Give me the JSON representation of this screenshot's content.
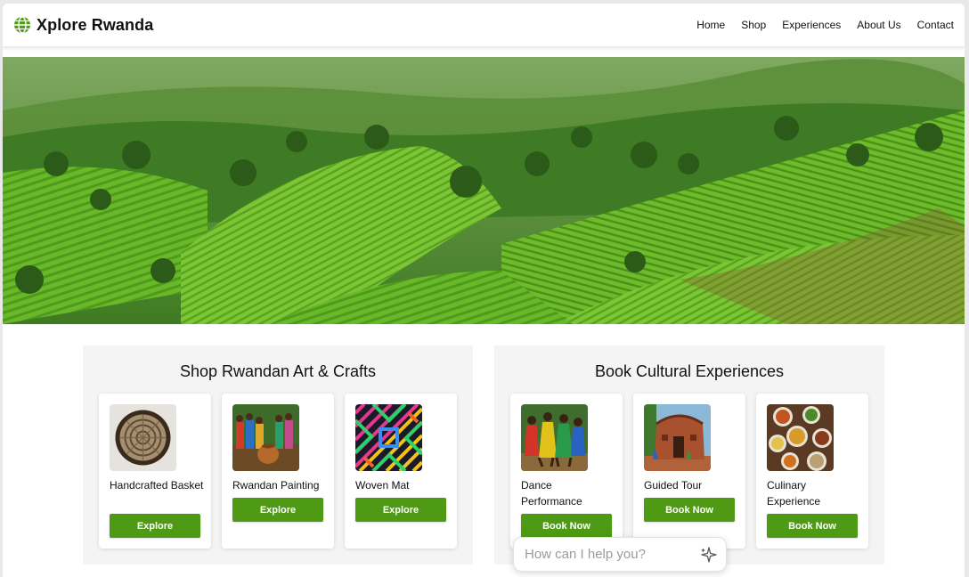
{
  "header": {
    "brand": "Xplore Rwanda",
    "brand_icon": "globe-icon",
    "nav": [
      "Home",
      "Shop",
      "Experiences",
      "About Us",
      "Contact"
    ]
  },
  "hero": {
    "icon": "tea-hills-landscape-image"
  },
  "sections": [
    {
      "title": "Shop Rwandan Art & Crafts",
      "cards": [
        {
          "title": "Handcrafted Basket",
          "image": "basket-image",
          "button": "Explore"
        },
        {
          "title": "Rwandan Painting",
          "image": "painting-image",
          "button": "Explore"
        },
        {
          "title": "Woven Mat",
          "image": "woven-mat-image",
          "button": "Explore"
        }
      ]
    },
    {
      "title": "Book Cultural Experiences",
      "cards": [
        {
          "title": "Dance Performance",
          "image": "dance-image",
          "button": "Book Now"
        },
        {
          "title": "Guided Tour",
          "image": "hut-image",
          "button": "Book Now"
        },
        {
          "title": "Culinary Experience",
          "image": "food-image",
          "button": "Book Now"
        }
      ]
    }
  ],
  "chat": {
    "placeholder": "How can I help you?",
    "icon": "sparkle-icon"
  },
  "colors": {
    "accent": "#4e9a14",
    "section_bg": "#f4f4f4"
  }
}
